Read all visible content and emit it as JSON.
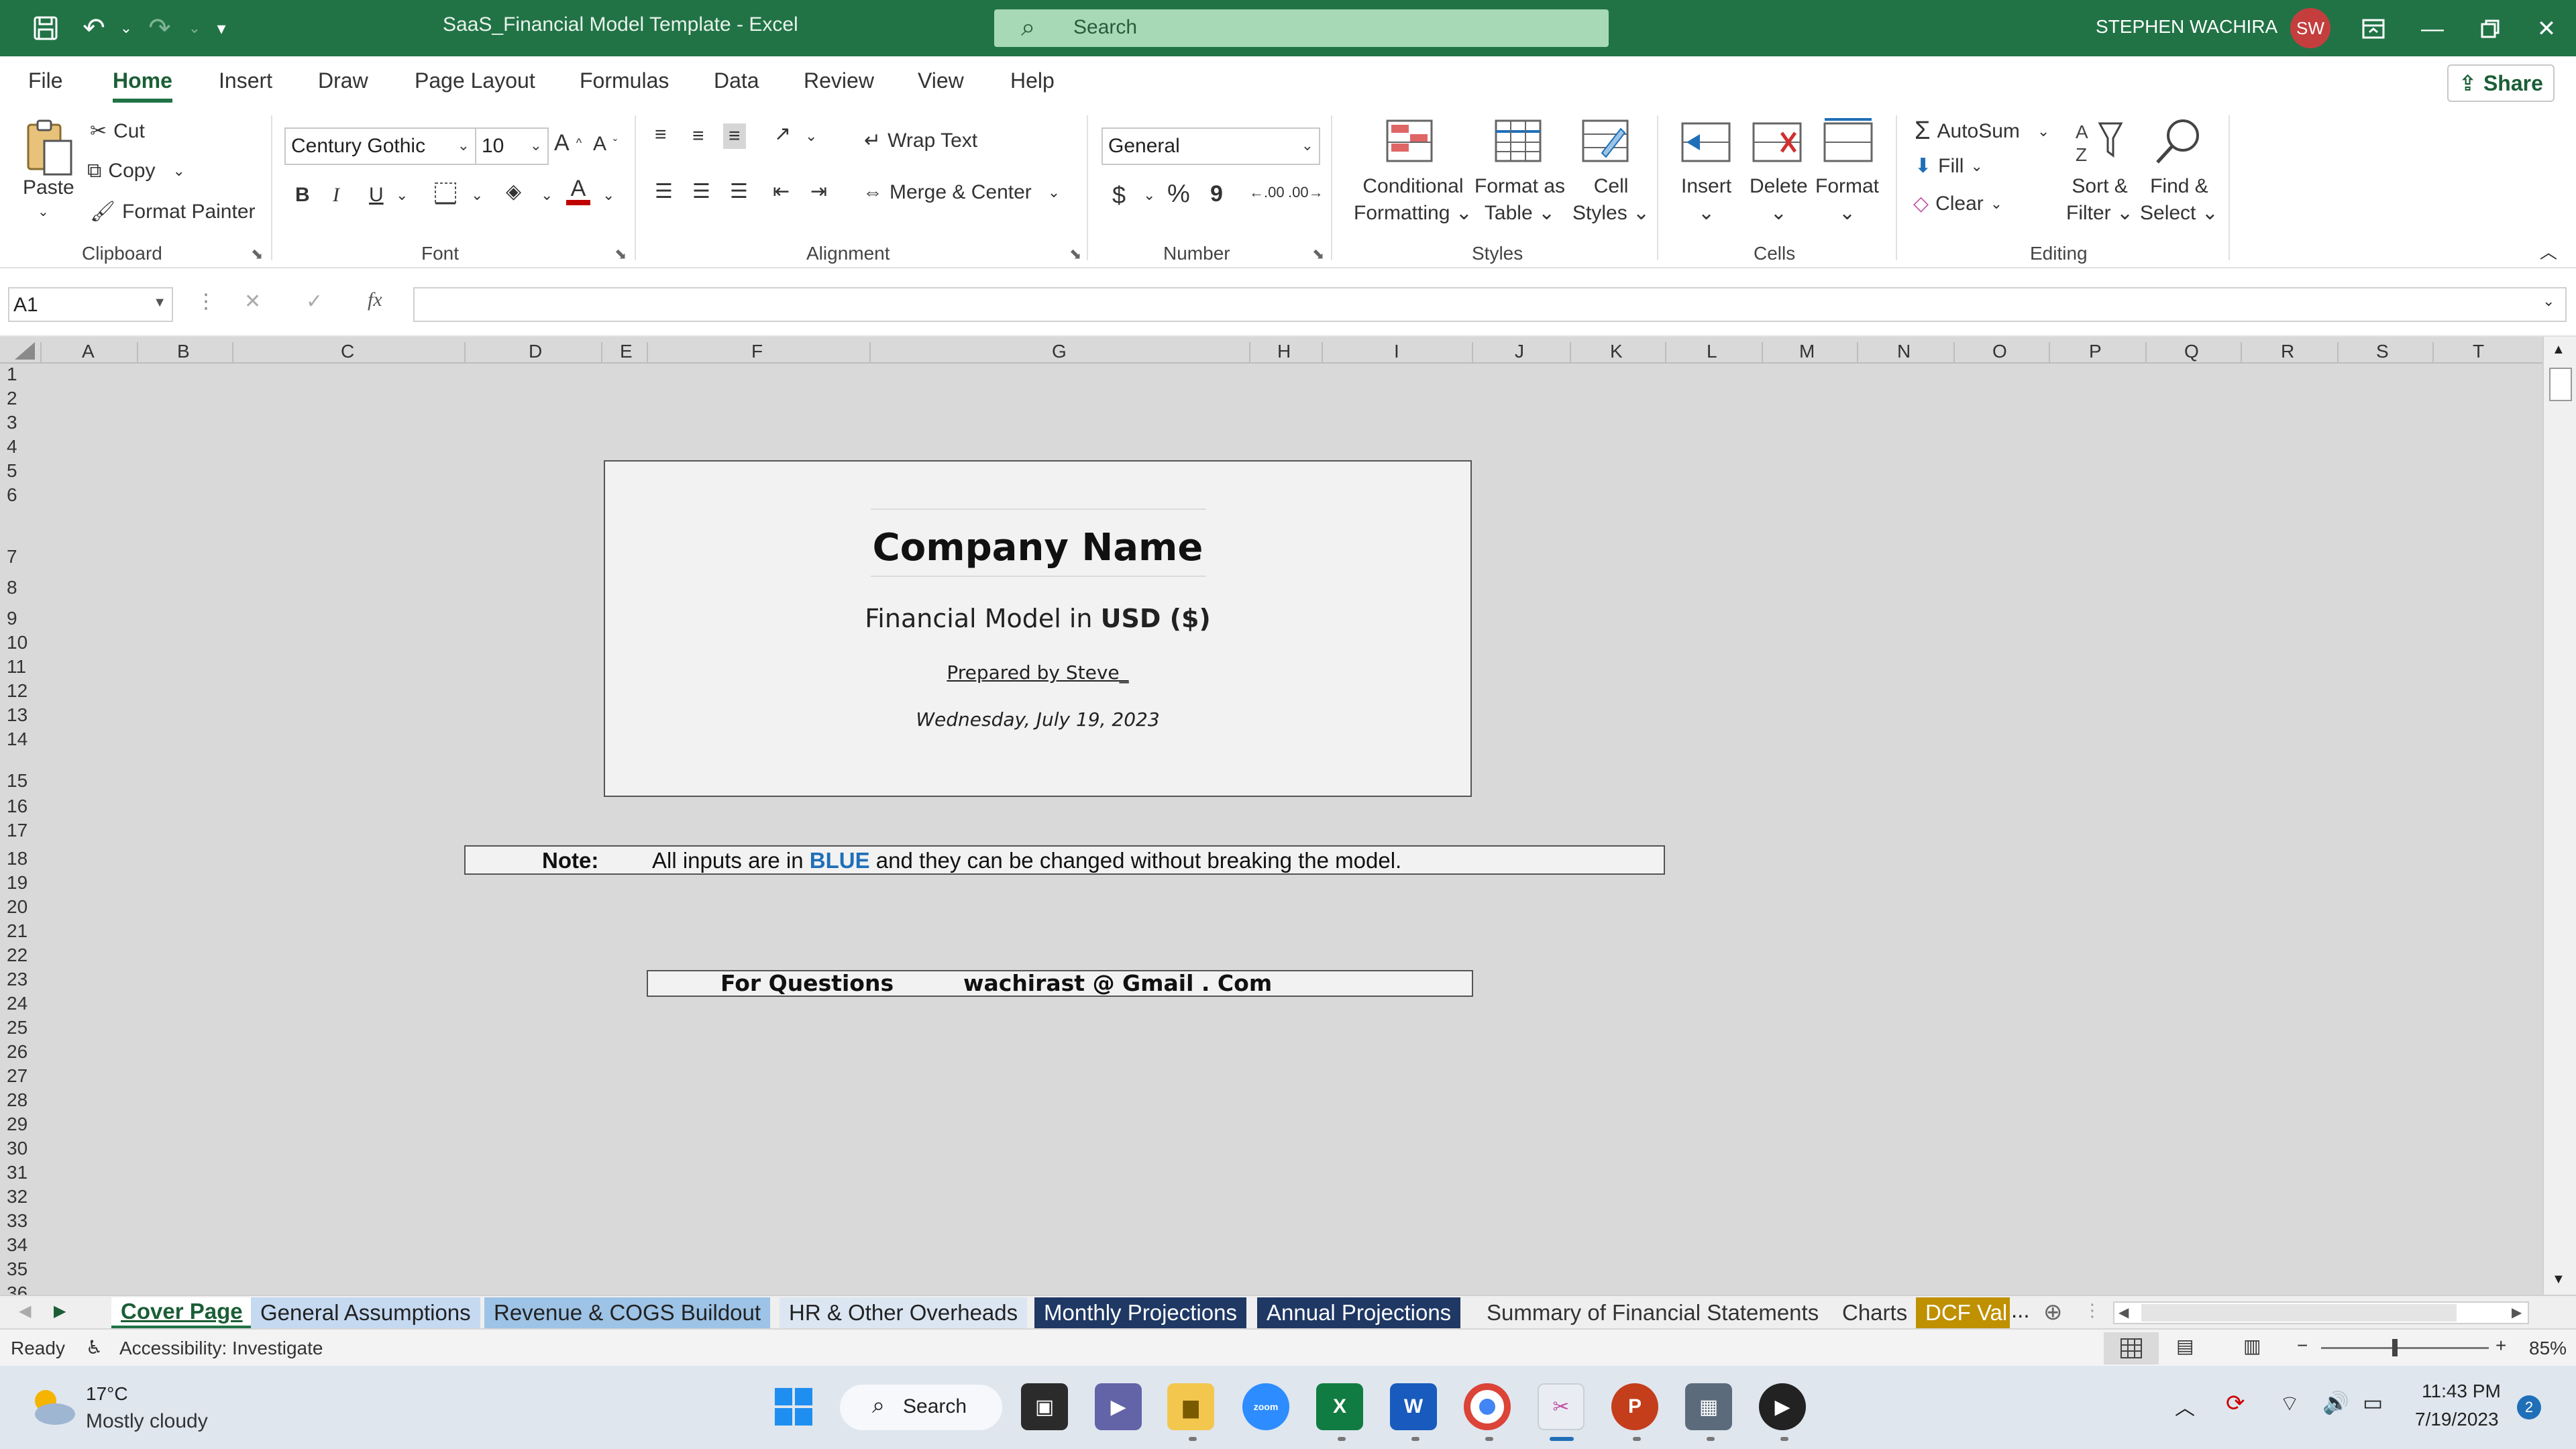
{
  "title_bar": {
    "doc_title": "SaaS_Financial Model Template  -  Excel",
    "search_placeholder": "Search",
    "user_name": "STEPHEN WACHIRA",
    "user_initials": "SW",
    "icons": [
      "save-icon",
      "undo-icon",
      "redo-icon",
      "customize-qat-icon",
      "ribbon-display-icon",
      "minimize-icon",
      "restore-icon",
      "close-icon"
    ]
  },
  "menu": {
    "tabs": [
      "File",
      "Home",
      "Insert",
      "Draw",
      "Page Layout",
      "Formulas",
      "Data",
      "Review",
      "View",
      "Help"
    ],
    "active": "Home",
    "share_label": "Share"
  },
  "ribbon": {
    "clipboard": {
      "paste": "Paste",
      "cut": "Cut",
      "copy": "Copy",
      "format_painter": "Format Painter",
      "label": "Clipboard"
    },
    "font": {
      "family": "Century Gothic",
      "size": "10",
      "bold": "B",
      "italic": "I",
      "underline": "U",
      "label": "Font"
    },
    "alignment": {
      "wrap_text": "Wrap Text",
      "merge_center": "Merge & Center",
      "label": "Alignment"
    },
    "number": {
      "format": "General",
      "currency": "$",
      "percent": "%",
      "comma": "9",
      "label": "Number"
    },
    "styles": {
      "conditional_1": "Conditional",
      "conditional_2": "Formatting",
      "format_table_1": "Format as",
      "format_table_2": "Table",
      "cell_styles_1": "Cell",
      "cell_styles_2": "Styles",
      "label": "Styles"
    },
    "cells": {
      "insert": "Insert",
      "delete": "Delete",
      "format": "Format",
      "label": "Cells"
    },
    "editing": {
      "autosum": "AutoSum",
      "fill": "Fill",
      "clear": "Clear",
      "sort_1": "Sort &",
      "sort_2": "Filter",
      "find_1": "Find &",
      "find_2": "Select",
      "label": "Editing"
    }
  },
  "formula_bar": {
    "name_box": "A1",
    "fx": "fx",
    "value": ""
  },
  "columns": [
    "A",
    "B",
    "C",
    "D",
    "E",
    "F",
    "G",
    "H",
    "I",
    "J",
    "K",
    "L",
    "M",
    "N",
    "O",
    "P",
    "Q",
    "R",
    "S",
    "T"
  ],
  "rows": [
    "1",
    "2",
    "3",
    "4",
    "5",
    "6",
    "7",
    "8",
    "9",
    "10",
    "11",
    "12",
    "13",
    "14",
    "15",
    "16",
    "17",
    "18",
    "19",
    "20",
    "21",
    "22",
    "23",
    "24",
    "25",
    "26",
    "27",
    "28",
    "29",
    "30",
    "31",
    "32",
    "33",
    "34",
    "35",
    "36"
  ],
  "cover": {
    "company_name": "Company Name",
    "model_prefix": "Financial  Model in ",
    "currency": "USD ($)",
    "prepared_by": "Prepared by Steve_",
    "date": "Wednesday, July 19, 2023"
  },
  "note": {
    "label": "Note:",
    "text_before": "All inputs are in ",
    "highlight": "BLUE",
    "text_after": " and they can be changed without breaking the model.",
    "highlight_color": "#1f6fb8"
  },
  "questions": {
    "label": "For Questions",
    "email": "wachirast @ Gmail .  Com"
  },
  "sheet_tabs": [
    {
      "label": "Cover Page",
      "bg": "#ffffff",
      "fg": "#1b5e36",
      "active": true
    },
    {
      "label": "General Assumptions",
      "bg": "#c5d9f1",
      "fg": "#1f1f1f"
    },
    {
      "label": "Revenue & COGS Buildout",
      "bg": "#9dc3e6",
      "fg": "#1f1f1f"
    },
    {
      "label": "HR & Other Overheads",
      "bg": "#dce6f2",
      "fg": "#1f1f1f"
    },
    {
      "label": "Monthly Projections",
      "bg": "#1f3864",
      "fg": "#ffffff"
    },
    {
      "label": "Annual Projections",
      "bg": "#1f3864",
      "fg": "#ffffff"
    },
    {
      "label": "Summary of Financial Statements",
      "bg": "#efefef",
      "fg": "#333333"
    },
    {
      "label": "Charts",
      "bg": "#efefef",
      "fg": "#333333"
    },
    {
      "label": "DCF Val",
      "bg": "#bf9000",
      "fg": "#ffffff"
    }
  ],
  "sheet_tabs_more": "...",
  "status": {
    "ready": "Ready",
    "accessibility": "Accessibility: Investigate",
    "zoom": "85%"
  },
  "taskbar": {
    "weather_temp": "17°C",
    "weather_desc": "Mostly cloudy",
    "search_label": "Search",
    "time": "11:43 PM",
    "date": "7/19/2023",
    "notification_count": "2"
  }
}
